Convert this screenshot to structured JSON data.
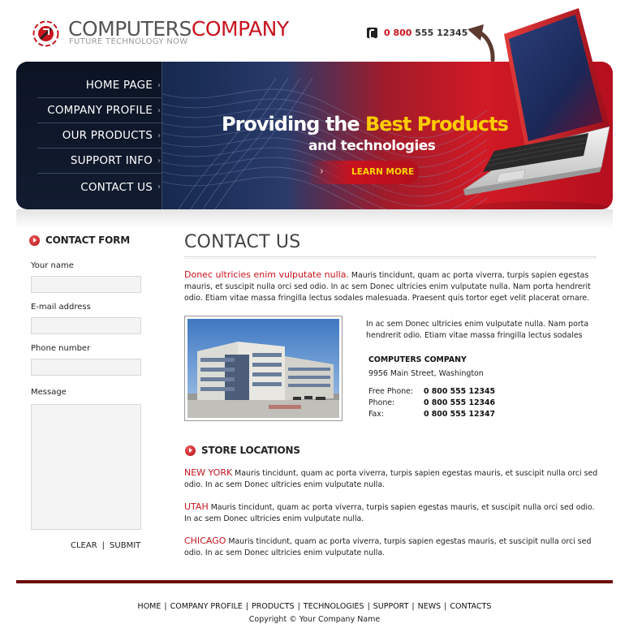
{
  "header": {
    "logo_part1": "COMPUTERS",
    "logo_part2": "COMPANY",
    "tagline": "FUTURE TECHNOLOGY NOW",
    "phone_prefix": "0 800",
    "phone_number": "555 12345",
    "phone_icon": "phone-icon"
  },
  "nav": {
    "items": [
      {
        "label": "HOME PAGE"
      },
      {
        "label": "COMPANY PROFILE"
      },
      {
        "label": "OUR PRODUCTS"
      },
      {
        "label": "SUPPORT INFO"
      },
      {
        "label": "CONTACT US"
      }
    ]
  },
  "banner": {
    "slogan_prefix": "Providing the ",
    "slogan_highlight": "Best Products",
    "slogan_line2": "and technologies",
    "cta_label": "LEARN MORE"
  },
  "contact_form": {
    "title": "CONTACT FORM",
    "fields": [
      {
        "label": "Your name",
        "value": ""
      },
      {
        "label": "E-mail address",
        "value": ""
      },
      {
        "label": "Phone number",
        "value": ""
      },
      {
        "label": "Message",
        "value": ""
      }
    ],
    "clear_label": "CLEAR",
    "separator": "|",
    "submit_label": "SUBMIT"
  },
  "main": {
    "title": "CONTACT US",
    "intro_lead": "Donec ultricies enim vulputate nulla.",
    "intro_body": " Mauris tincidunt, quam ac porta viverra, turpis sapien egestas mauris, et suscipit nulla orci sed odio. In ac sem Donec ultricies enim vulputate nulla. Nam porta hendrerit odio. Etiam vitae massa fringilla lectus sodales malesuada. Praesent quis tortor eget velit placerat ornare.",
    "side_text": "In ac sem Donec ultricies enim vulputate nulla. Nam porta hendrerit odio. Etiam vitae massa fringilla lectus sodales",
    "company_name": "COMPUTERS COMPANY",
    "address": "9956 Main Street, Washington",
    "contacts": [
      {
        "label": "Free Phone:",
        "value": "0 800 555 12345"
      },
      {
        "label": "Phone:",
        "value": "0 800 555 12346"
      },
      {
        "label": "Fax:",
        "value": "0 800 555 12347"
      }
    ],
    "stores_title": "STORE LOCATIONS",
    "stores": [
      {
        "city": "NEW YORK",
        "text": " Mauris tincidunt, quam ac porta viverra, turpis sapien egestas mauris, et suscipit nulla orci sed odio. In ac sem Donec ultricies enim vulputate nulla."
      },
      {
        "city": "UTAH",
        "text": " Mauris tincidunt, quam ac porta viverra, turpis sapien egestas mauris, et suscipit nulla orci sed odio. In ac sem Donec ultricies enim vulputate nulla."
      },
      {
        "city": "CHICAGO",
        "text": " Mauris tincidunt, quam ac porta viverra, turpis sapien egestas mauris, et suscipit nulla orci sed odio. In ac sem Donec ultricies enim vulputate nulla."
      }
    ]
  },
  "footer": {
    "links": [
      "HOME",
      "COMPANY PROFILE",
      "PRODUCTS",
      "TECHNOLOGIES",
      "SUPPORT",
      "NEWS",
      "CONTACTS"
    ],
    "separator": "|",
    "copyright": "Copyright © Your Company Name"
  },
  "colors": {
    "brand_red": "#c8141e",
    "nav_dark": "#0c1424",
    "highlight_yellow": "#ffcc00",
    "footer_rule": "#6e0b0b"
  }
}
